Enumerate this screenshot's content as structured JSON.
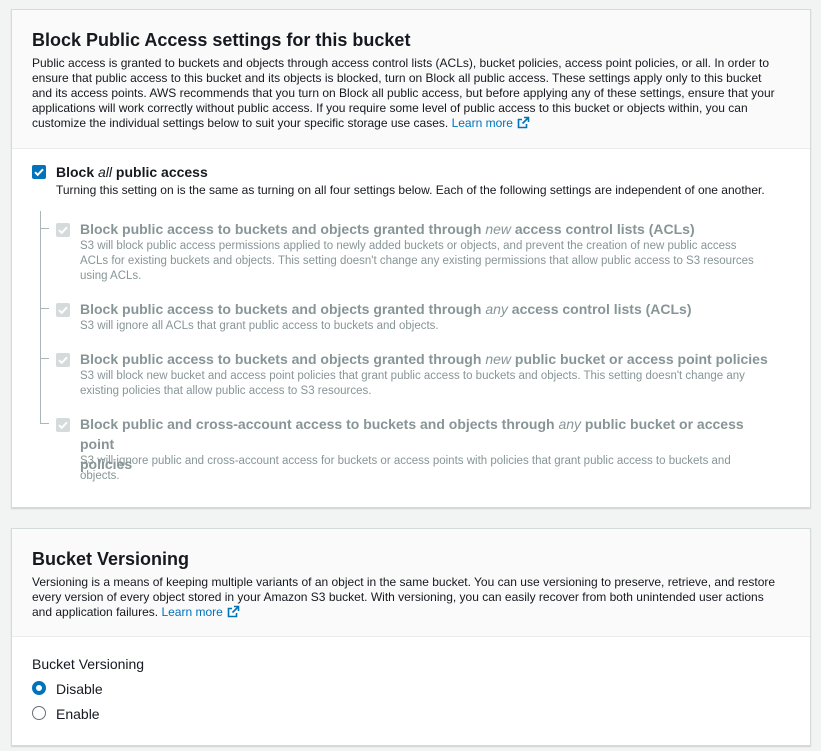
{
  "block_public_access": {
    "title": "Block Public Access settings for this bucket",
    "description_lines": [
      "Public access is granted to buckets and objects through access control lists (ACLs), bucket policies, access point policies, or all. In order to",
      "ensure that public access to this bucket and its objects is blocked, turn on Block all public access. These settings apply only to this bucket",
      "and its access points. AWS recommends that you turn on Block all public access, but before applying any of these settings, ensure that your",
      "applications will work correctly without public access. If you require some level of public access to this bucket or objects within, you can",
      "customize the individual settings below to suit your specific storage use cases."
    ],
    "learn_more": "Learn more",
    "main_option": {
      "label_prefix": "Block",
      "label_emphasis": "all",
      "label_suffix": "public access",
      "checked": true,
      "description": "Turning this setting on is the same as turning on all four settings below. Each of the following settings are independent of one another."
    },
    "sub_options": [
      {
        "title_before": "Block public access to buckets and objects granted through",
        "title_emphasis": "new",
        "title_after": "access control lists (ACLs)",
        "description_lines": [
          "S3 will block public access permissions applied to newly added buckets or objects, and prevent the creation of new public access",
          "ACLs for existing buckets and objects. This setting doesn't change any existing permissions that allow public access to S3 resources",
          "using ACLs."
        ],
        "checked": true
      },
      {
        "title_before": "Block public access to buckets and objects granted through",
        "title_emphasis": "any",
        "title_after": "access control lists (ACLs)",
        "description_lines": [
          "S3 will ignore all ACLs that grant public access to buckets and objects."
        ],
        "checked": true
      },
      {
        "title_before": "Block public access to buckets and objects granted through",
        "title_emphasis": "new",
        "title_after": "public bucket or access point policies",
        "description_lines": [
          "S3 will block new bucket and access point policies that grant public access to buckets and objects. This setting doesn't change any",
          "existing policies that allow public access to S3 resources."
        ],
        "checked": true
      },
      {
        "title_before": "Block public and cross-account access to buckets and objects through",
        "title_emphasis": "any",
        "title_after": "public bucket or access point",
        "title_line2": "policies",
        "description_lines": [
          "S3 will ignore public and cross-account access for buckets or access points with policies that grant public access to buckets and",
          "objects."
        ],
        "checked": true
      }
    ]
  },
  "bucket_versioning": {
    "title": "Bucket Versioning",
    "description_lines": [
      "Versioning is a means of keeping multiple variants of an object in the same bucket. You can use versioning to preserve, retrieve, and restore",
      "every version of every object stored in your Amazon S3 bucket. With versioning, you can easily recover from both unintended user actions",
      "and application failures."
    ],
    "learn_more": "Learn more",
    "field_label": "Bucket Versioning",
    "options": [
      {
        "label": "Disable",
        "selected": true
      },
      {
        "label": "Enable",
        "selected": false
      }
    ]
  },
  "colors": {
    "accent": "#0073bb",
    "disabled_text": "#879596",
    "panel_header_bg": "#fafafa"
  },
  "icons": {
    "external_link": "external-link-icon",
    "checkbox": "check-icon"
  }
}
